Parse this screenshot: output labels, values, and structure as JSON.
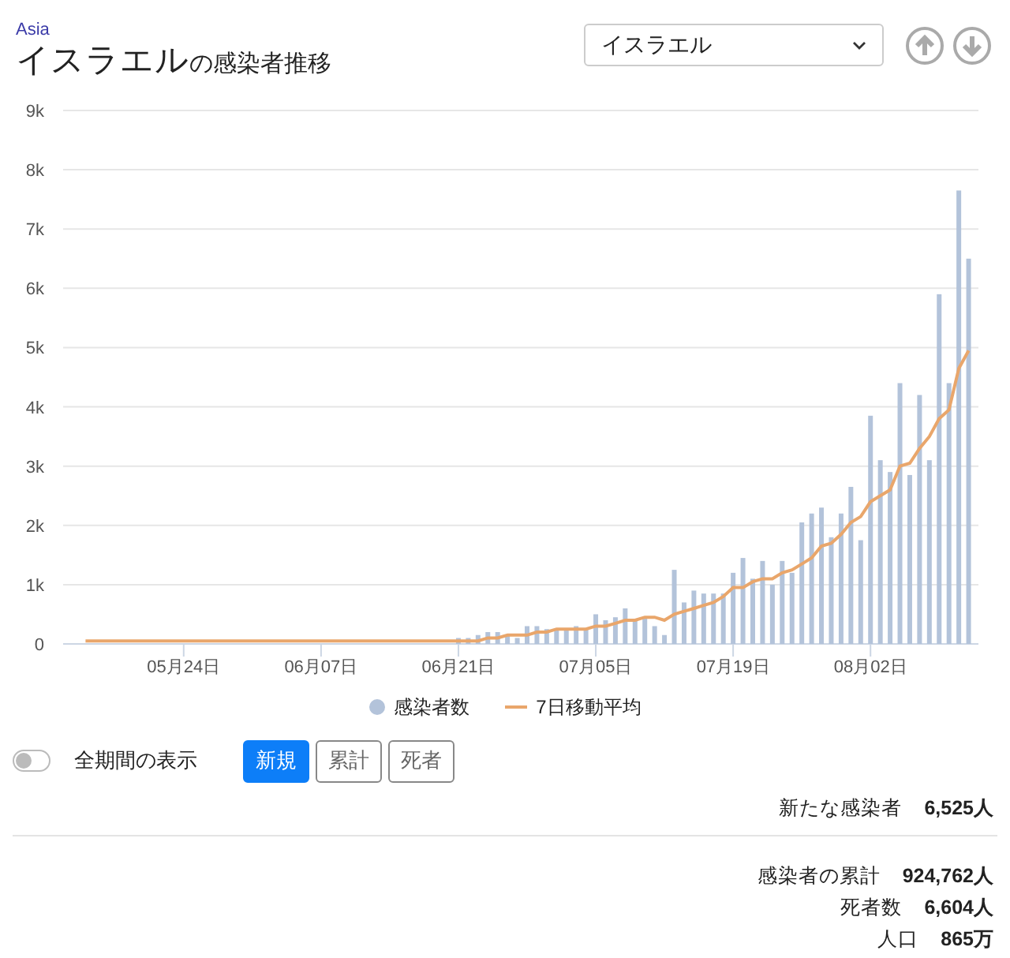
{
  "header": {
    "region": "Asia",
    "title": "イスラエル",
    "title_suffix": "の感染者推移",
    "country_select": {
      "value": "イスラエル"
    }
  },
  "chart": {
    "chart_data": {
      "type": "bar",
      "categories": [
        null,
        null,
        null,
        null,
        null,
        null,
        null,
        null,
        null,
        null,
        "05月24日",
        null,
        null,
        null,
        null,
        null,
        null,
        null,
        null,
        null,
        null,
        null,
        null,
        null,
        "06月07日",
        null,
        null,
        null,
        null,
        null,
        null,
        null,
        null,
        null,
        null,
        null,
        null,
        null,
        "06月21日",
        null,
        null,
        null,
        null,
        null,
        null,
        null,
        null,
        null,
        null,
        null,
        null,
        null,
        "07月05日",
        null,
        null,
        null,
        null,
        null,
        null,
        null,
        null,
        null,
        null,
        null,
        null,
        null,
        "07月19日",
        null,
        null,
        null,
        null,
        null,
        null,
        null,
        null,
        null,
        null,
        null,
        null,
        null,
        "08月02日",
        null,
        null,
        null,
        null,
        null,
        null,
        null,
        null,
        null,
        null
      ],
      "series": [
        {
          "name": "感染者数",
          "color": "#b3c3da",
          "type": "bar",
          "values": [
            0,
            0,
            0,
            0,
            0,
            0,
            0,
            0,
            0,
            0,
            0,
            0,
            0,
            0,
            0,
            0,
            0,
            0,
            0,
            0,
            0,
            0,
            0,
            0,
            0,
            0,
            0,
            0,
            0,
            0,
            0,
            0,
            0,
            0,
            0,
            0,
            0,
            0,
            100,
            100,
            150,
            200,
            200,
            150,
            100,
            300,
            300,
            250,
            250,
            250,
            300,
            250,
            500,
            400,
            450,
            600,
            400,
            450,
            300,
            150,
            1250,
            700,
            900,
            850,
            850,
            850,
            1200,
            1450,
            1100,
            1400,
            1000,
            1400,
            1200,
            2050,
            2200,
            2300,
            1800,
            2200,
            2650,
            1750,
            3850,
            3100,
            2900,
            4400,
            2850,
            4200,
            3100,
            5900,
            4400,
            7650,
            6500
          ]
        },
        {
          "name": "7日移動平均",
          "color": "#e9a66b",
          "type": "line",
          "values": [
            50,
            50,
            50,
            50,
            50,
            50,
            50,
            50,
            50,
            50,
            50,
            50,
            50,
            50,
            50,
            50,
            50,
            50,
            50,
            50,
            50,
            50,
            50,
            50,
            50,
            50,
            50,
            50,
            50,
            50,
            50,
            50,
            50,
            50,
            50,
            50,
            50,
            50,
            50,
            50,
            50,
            100,
            100,
            150,
            150,
            150,
            200,
            200,
            250,
            250,
            250,
            250,
            300,
            300,
            350,
            400,
            400,
            450,
            450,
            400,
            500,
            550,
            600,
            650,
            700,
            800,
            950,
            950,
            1050,
            1100,
            1100,
            1200,
            1250,
            1350,
            1450,
            1650,
            1700,
            1850,
            2050,
            2150,
            2400,
            2500,
            2600,
            3000,
            3050,
            3300,
            3500,
            3800,
            3950,
            4650,
            4950
          ]
        }
      ],
      "ylim": [
        0,
        9000
      ],
      "grid": true,
      "yticks": [
        {
          "value": 0,
          "label": "0"
        },
        {
          "value": 1000,
          "label": "1k"
        },
        {
          "value": 2000,
          "label": "2k"
        },
        {
          "value": 3000,
          "label": "3k"
        },
        {
          "value": 4000,
          "label": "4k"
        },
        {
          "value": 5000,
          "label": "5k"
        },
        {
          "value": 6000,
          "label": "6k"
        },
        {
          "value": 7000,
          "label": "7k"
        },
        {
          "value": 8000,
          "label": "8k"
        },
        {
          "value": 9000,
          "label": "9k"
        }
      ]
    }
  },
  "period_toggle": {
    "label": "全期間の表示",
    "on": false
  },
  "tabs": [
    {
      "label": "新規",
      "selected": true
    },
    {
      "label": "累計",
      "selected": false
    },
    {
      "label": "死者",
      "selected": false
    }
  ],
  "daily_stats": [
    {
      "label": "新たな感染者",
      "value": "6,525人"
    }
  ],
  "total_stats": [
    {
      "label": "感染者の累計",
      "value": "924,762人"
    },
    {
      "label": "死者数",
      "value": "6,604人"
    },
    {
      "label": "人口",
      "value": "865万"
    }
  ]
}
